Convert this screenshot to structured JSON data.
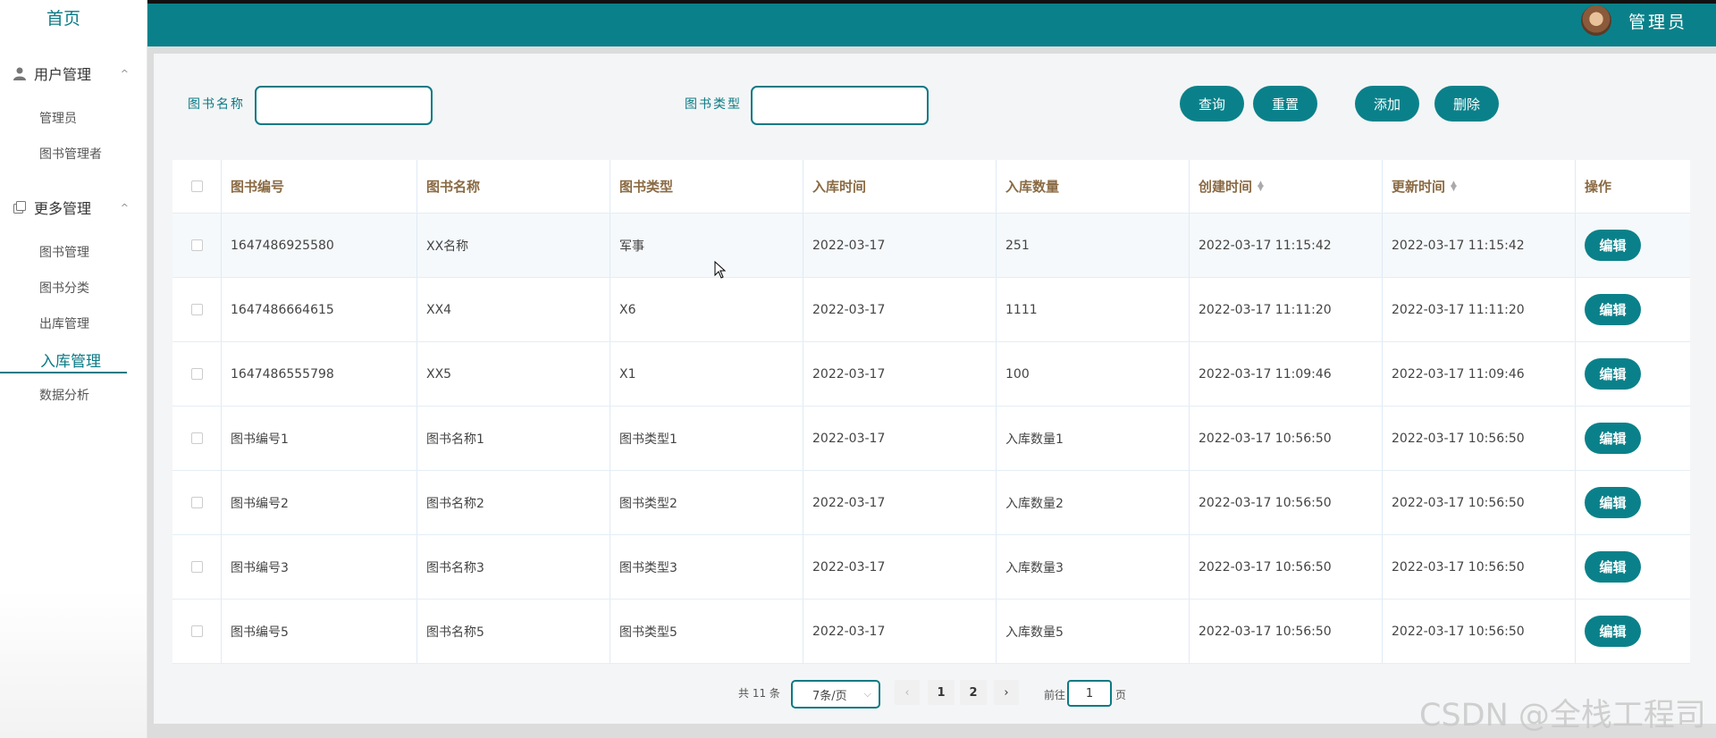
{
  "sidebar": {
    "home": "首页",
    "user_group": "用户管理",
    "user_items": [
      "管理员",
      "图书管理者"
    ],
    "more_group": "更多管理",
    "more_items": [
      "图书管理",
      "图书分类",
      "出库管理",
      "入库管理",
      "数据分析"
    ],
    "active_item": "入库管理"
  },
  "header": {
    "admin_name": "管理员"
  },
  "search": {
    "book_name_label": "图书名称",
    "book_type_label": "图书类型"
  },
  "buttons": {
    "query": "查询",
    "reset": "重置",
    "add": "添加",
    "delete": "删除",
    "edit": "编辑"
  },
  "table": {
    "columns": [
      "图书编号",
      "图书名称",
      "图书类型",
      "入库时间",
      "入库数量",
      "创建时间",
      "更新时间",
      "操作"
    ],
    "rows": [
      [
        "1647486925580",
        "XX名称",
        "军事",
        "2022-03-17",
        "251",
        "2022-03-17 11:15:42",
        "2022-03-17 11:15:42"
      ],
      [
        "1647486664615",
        "XX4",
        "X6",
        "2022-03-17",
        "1111",
        "2022-03-17 11:11:20",
        "2022-03-17 11:11:20"
      ],
      [
        "1647486555798",
        "XX5",
        "X1",
        "2022-03-17",
        "100",
        "2022-03-17 11:09:46",
        "2022-03-17 11:09:46"
      ],
      [
        "图书编号1",
        "图书名称1",
        "图书类型1",
        "2022-03-17",
        "入库数量1",
        "2022-03-17 10:56:50",
        "2022-03-17 10:56:50"
      ],
      [
        "图书编号2",
        "图书名称2",
        "图书类型2",
        "2022-03-17",
        "入库数量2",
        "2022-03-17 10:56:50",
        "2022-03-17 10:56:50"
      ],
      [
        "图书编号3",
        "图书名称3",
        "图书类型3",
        "2022-03-17",
        "入库数量3",
        "2022-03-17 10:56:50",
        "2022-03-17 10:56:50"
      ],
      [
        "图书编号5",
        "图书名称5",
        "图书类型5",
        "2022-03-17",
        "入库数量5",
        "2022-03-17 10:56:50",
        "2022-03-17 10:56:50"
      ]
    ]
  },
  "pagination": {
    "total": "共 11 条",
    "page_size": "7条/页",
    "prev": "‹",
    "pages": [
      "1",
      "2"
    ],
    "next": "›",
    "goto_prefix": "前往",
    "goto_value": "1",
    "goto_suffix": "页"
  },
  "watermark": "CSDN @全栈工程司",
  "colors": {
    "accent": "#0a818a",
    "header_text": "#8a6a43"
  }
}
